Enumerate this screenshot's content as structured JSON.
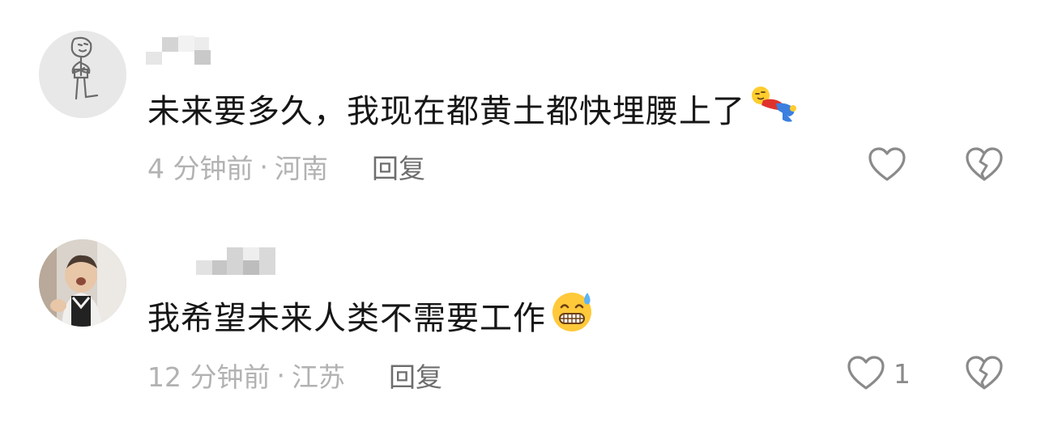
{
  "comments": [
    {
      "text": "未来要多久，我现在都黄土都快埋腰上了",
      "emoji": "lying-doll-emoji",
      "time": "4 分钟前",
      "location": "河南",
      "reply_label": "回复",
      "like_count": ""
    },
    {
      "text": "我希望未来人类不需要工作",
      "emoji": "grinning-sweat-emoji",
      "time": "12 分钟前",
      "location": "江苏",
      "reply_label": "回复",
      "like_count": "1"
    }
  ],
  "separator": "·",
  "colors": {
    "text": "#161616",
    "meta": "#b2b2b2",
    "reply": "#6e6e6e",
    "icon": "#8a8a8a"
  }
}
